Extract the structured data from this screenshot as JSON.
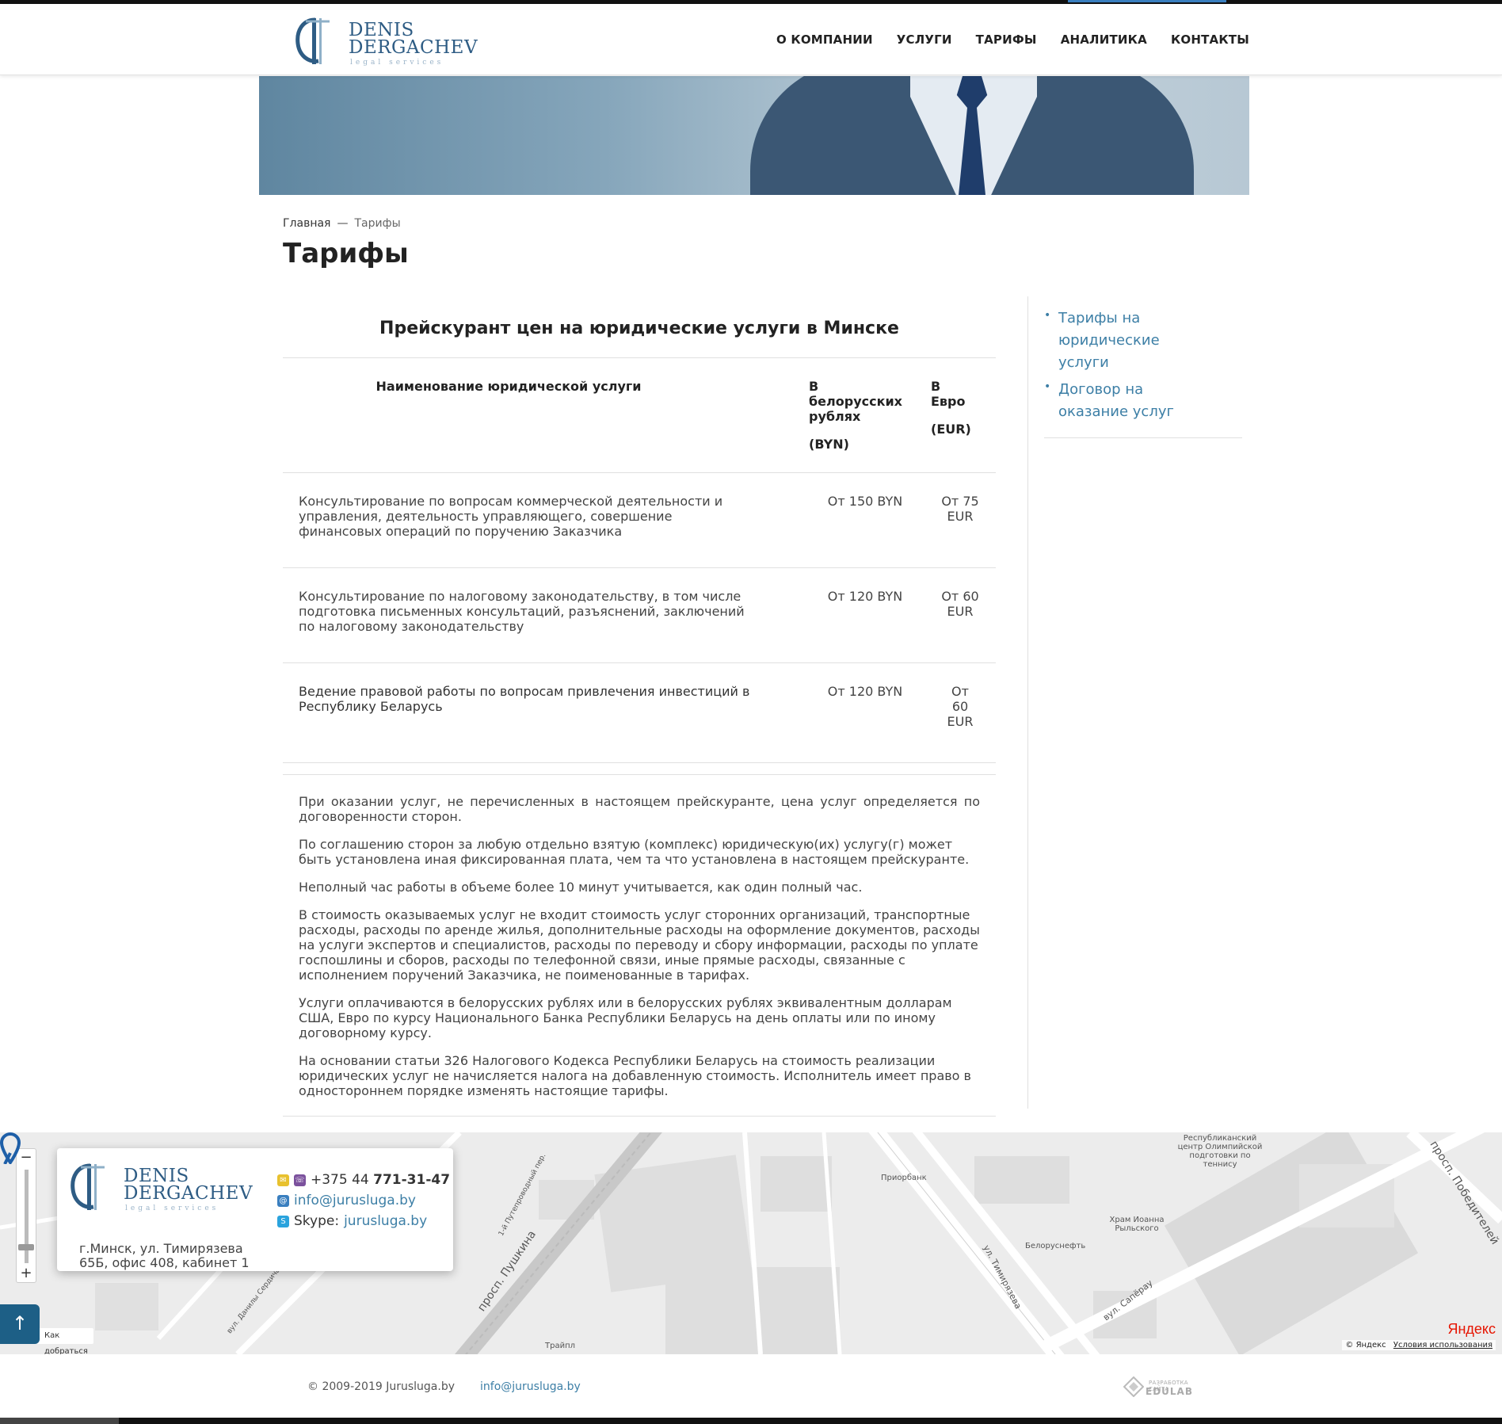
{
  "logo": {
    "name_line1": "DENIS",
    "name_line2": "DERGACHEV",
    "tagline": "legal services"
  },
  "nav": [
    "О КОМПАНИИ",
    "УСЛУГИ",
    "ТАРИФЫ",
    "АНАЛИТИКА",
    "КОНТАКТЫ"
  ],
  "breadcrumb": {
    "home": "Главная",
    "separator": "—",
    "current": "Тарифы"
  },
  "page_title": "Тарифы",
  "price": {
    "title": "Прейскурант цен на юридические услуги в Минске",
    "headers": {
      "name": "Наименование юридической услуги",
      "byn_1": "В",
      "byn_2": "белорусских",
      "byn_3": "рублях",
      "byn_code": "(BYN)",
      "eur_1": "В",
      "eur_2": "Евро",
      "eur_code": "(EUR)"
    },
    "rows": [
      {
        "service": "Консультирование по вопросам коммерческой деятельности и управления, деятельность управляющего, совершение финансовых операций по поручению Заказчика",
        "byn": "От 150 BYN",
        "eur": "От 75 EUR"
      },
      {
        "service": "Консультирование по налоговому законодательству, в том числе подготовка письменных консультаций, разъяснений, заключений по налоговому законодательству",
        "byn": "От 120 BYN",
        "eur": "От 60 EUR"
      },
      {
        "service": "Ведение правовой работы по вопросам привлечения инвестиций в Республику Беларусь",
        "byn": "От 120 BYN",
        "eur": "От 60 EUR"
      }
    ]
  },
  "notes": [
    "При оказании услуг, не перечисленных в настоящем прейскуранте, цена услуг определяется по договоренности сторон.",
    "По соглашению сторон за любую отдельно взятую (комплекс) юридическую(их) услугу(г) может быть установлена иная фиксированная плата, чем та что установлена в настоящем прейскуранте.",
    "Неполный час работы в объеме более 10 минут учитывается, как один полный час.",
    "В стоимость оказываемых услуг не входит стоимость услуг сторонних организаций, транспортные расходы, расходы по аренде жилья, дополнительные расходы на оформление документов, расходы на услуги экспертов и специалистов, расходы по переводу и сбору информации, расходы по уплате госпошлины и сборов, расходы по телефонной связи, иные прямые расходы, связанные с исполнением поручений Заказчика, не поименованные в тарифах.",
    "Услуги оплачиваются в белорусских рублях или в белорусских рублях эквивалентным долларам США, Евро по курсу Национального Банка Республики Беларусь на день оплаты или по иному договорному курсу.",
    "На основании статьи 326 Налогового Кодекса Республики Беларусь на стоимость реализации юридических услуг не начисляется налога на добавленную стоимость. Исполнитель имеет право в одностороннем порядке изменять настоящие тарифы."
  ],
  "sidebar": [
    {
      "line1": "Тарифы на",
      "line2": "юридические",
      "line3": "услуги"
    },
    {
      "line1": "Договор на",
      "line2": "оказание услуг"
    }
  ],
  "contact": {
    "address_line1": "г.Минск, ул. Тимирязева",
    "address_line2": "65Б, офис 408, кабинет 1",
    "phone_prefix": "+375 44",
    "phone_main": "771-31-47",
    "email": "info@jurusluga.by",
    "skype_label": "Skype:",
    "skype": "jurusluga.by"
  },
  "map": {
    "route_label": "Как добраться",
    "streets": [
      "просп. Пушкина",
      "ул. Тимирязева",
      "вул. Сапёрау",
      "просп. Победителей",
      "1-й Путепроводный пер.",
      "вул. Данилы Сердича"
    ],
    "pois": [
      "Приорбанк",
      "Белоруснефть",
      "Храм Иоанна Рыльского",
      "Республиканский центр Олимпийской подготовки по теннису",
      "Трайпл"
    ],
    "copyright": "© Яндекс",
    "terms": "Условия использования",
    "brand": "Яндекс"
  },
  "footer": {
    "copyright": "© 2009-2019 Jurusluga.by",
    "email": "info@jurusluga.by",
    "dev_label": "РАЗРАБОТКА САЙТА",
    "dev_name": "EDULAB"
  },
  "colors": {
    "brand_blue": "#2e5c84",
    "link_blue": "#3d7fa6",
    "scroll_button": "#1d5f86"
  }
}
